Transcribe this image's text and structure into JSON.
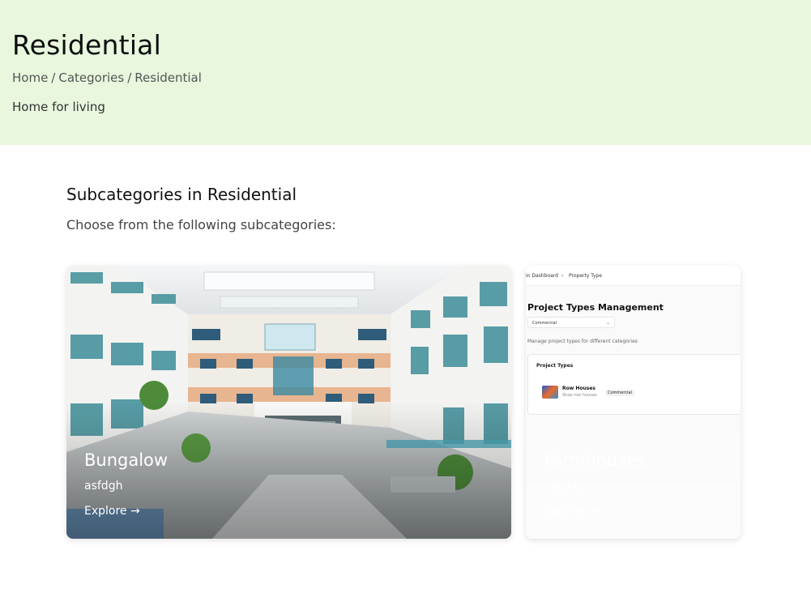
{
  "hero": {
    "title": "Residential",
    "breadcrumb": [
      "Home",
      "Categories",
      "Residential"
    ],
    "separator": "/",
    "description": "Home for living"
  },
  "section": {
    "title": "Subcategories in Residential",
    "subtitle": "Choose from the following subcategories:"
  },
  "cards": [
    {
      "title": "Bungalow",
      "tagline": "asfdgh",
      "explore": "Explore →"
    },
    {
      "title": "Farmhouses",
      "tagline": "sdgjhg",
      "explore": "Explore →"
    }
  ],
  "mini_screenshot": {
    "breadcrumb": [
      "in Dashboard",
      "›",
      "Property Type"
    ],
    "heading": "Project Types Management",
    "select_value": "Commercial",
    "hint": "Manage project types for different categories",
    "panel_title": "Project Types",
    "row": {
      "name": "Row Houses",
      "sub": "Shop row houses",
      "badge": "Commercial"
    }
  }
}
